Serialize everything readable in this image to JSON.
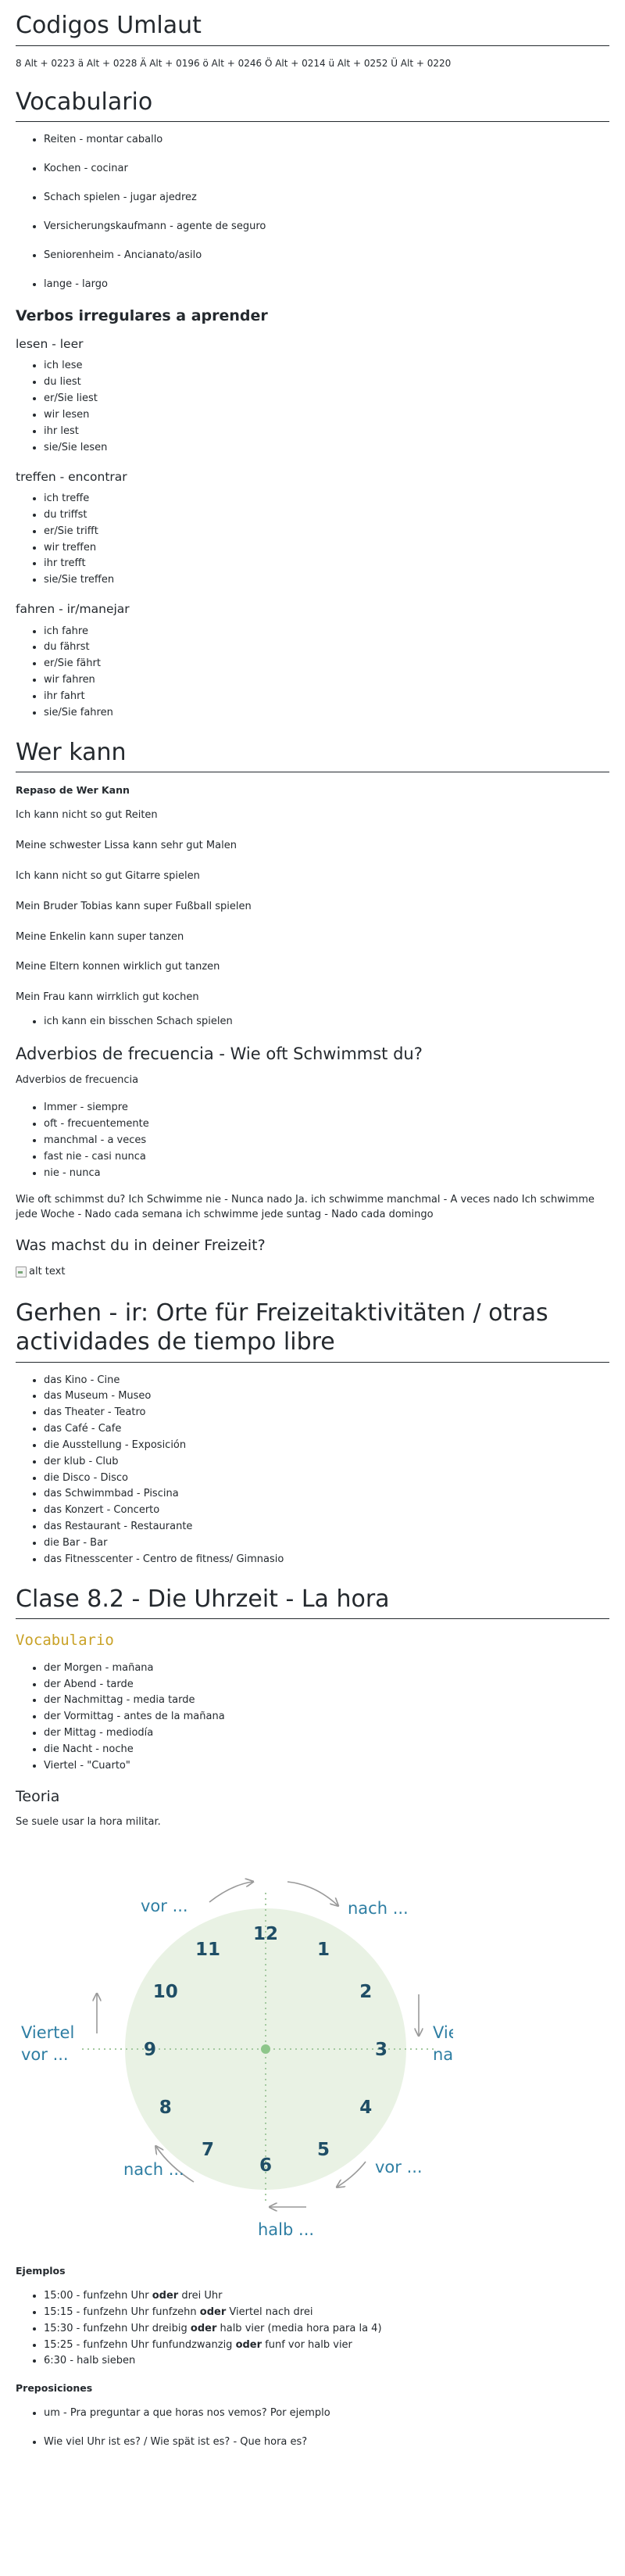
{
  "umlaut": {
    "title": "Codigos Umlaut",
    "codes": "8 Alt + 0223 ä Alt + 0228 Ä Alt + 0196 ö Alt + 0246 Ö Alt + 0214 ü Alt + 0252 Ü Alt + 0220"
  },
  "vocabulario": {
    "title": "Vocabulario",
    "items": [
      "Reiten - montar caballo",
      "Kochen - cocinar",
      "Schach spielen - jugar ajedrez",
      "Versicherungskaufmann - agente de seguro",
      "Seniorenheim - Ancianato/asilo",
      "lange - largo"
    ],
    "verbs_title": "Verbos irregulares a aprender",
    "verbs": [
      {
        "title": "lesen - leer",
        "forms": [
          "ich lese",
          "du liest",
          "er/Sie liest",
          "wir lesen",
          "ihr lest",
          "sie/Sie lesen"
        ]
      },
      {
        "title": "treffen - encontrar",
        "forms": [
          "ich treffe",
          "du triffst",
          "er/Sie trifft",
          "wir treffen",
          "ihr trefft",
          "sie/Sie treffen"
        ]
      },
      {
        "title": "fahren - ir/manejar",
        "forms": [
          "ich fahre",
          "du fährst",
          "er/Sie fährt",
          "wir fahren",
          "ihr fahrt",
          "sie/Sie fahren"
        ]
      }
    ]
  },
  "werkann": {
    "title": "Wer kann",
    "repaso": "Repaso de Wer Kann",
    "sentences": [
      "Ich kann nicht so gut Reiten",
      "Meine schwester Lissa kann sehr gut Malen",
      "Ich kann nicht so gut Gitarre spielen",
      "Mein Bruder Tobias kann super Fußball spielen",
      "Meine Enkelin kann super tanzen",
      "Meine Eltern konnen wirklich gut tanzen",
      "Mein Frau kann wirrklich gut kochen"
    ],
    "bullet": "ich kann ein bisschen Schach spielen",
    "adverbios_title": "Adverbios de frecuencia - Wie oft Schwimmst du?",
    "adverbios_intro": "Adverbios de frecuencia",
    "adverbios": [
      "Immer - siempre",
      "oft - frecuentemente",
      "manchmal - a veces",
      "fast nie - casi nunca",
      "nie - nunca"
    ],
    "paragraph": "Wie oft schimmst du? Ich Schwimme nie - Nunca nado Ja. ich schwimme manchmal - A veces nado Ich schwimme jede Woche - Nado cada semana ich schwimme jede suntag - Nado cada domingo",
    "freizeit_title": "Was machst du in deiner Freizeit?",
    "img_alt": "alt text"
  },
  "gehen": {
    "title": "Gerhen - ir: Orte für Freizeitaktivitäten / otras actividades de tiempo libre",
    "items": [
      "das Kino - Cine",
      "das Museum - Museo",
      "das Theater - Teatro",
      "das Café - Cafe",
      "die Ausstellung - Exposición",
      "der klub - Club",
      "die Disco - Disco",
      "das Schwimmbad - Piscina",
      "das Konzert - Concerto",
      "das Restaurant - Restaurante",
      "die Bar - Bar",
      "das Fitnesscenter - Centro de fitness/ Gimnasio"
    ]
  },
  "clase": {
    "title": "Clase 8.2 - Die Uhrzeit - La hora",
    "vocab_title": "Vocabulario",
    "vocab": [
      "der Morgen - mañana",
      "der Abend - tarde",
      "der Nachmittag - media tarde",
      "der Vormittag - antes de la mañana",
      "der Mittag - mediodía",
      "die Nacht - noche",
      "Viertel - \"Cuarto\""
    ],
    "teoria_title": "Teoria",
    "teoria_text": "Se suele usar la hora militar.",
    "clock": {
      "numbers": [
        "12",
        "1",
        "2",
        "3",
        "4",
        "5",
        "6",
        "7",
        "8",
        "9",
        "10",
        "11"
      ],
      "vor_top": "vor ...",
      "nach_top": "nach ...",
      "viertel": "Viertel",
      "vor_left": "vor ...",
      "nach_right": "nach ...",
      "nach_bottom": "nach ...",
      "vor_bottom": "vor ...",
      "halb": "halb ...",
      "face_color": "#e9f2e4",
      "number_color": "#1f4e66",
      "label_color": "#2e7ea3",
      "arrow_color": "#999999",
      "center_color": "#8dc68a"
    },
    "ejemplos_title": "Ejemplos",
    "ejemplos": [
      {
        "pre": "15:00 - funfzehn Uhr ",
        "bold": "oder",
        "post": " drei Uhr"
      },
      {
        "pre": "15:15 - funfzehn Uhr funfzehn ",
        "bold": "oder",
        "post": " Viertel nach drei"
      },
      {
        "pre": "15:30 - funfzehn Uhr dreibig ",
        "bold": "oder",
        "post": " halb vier (media hora para la 4)"
      },
      {
        "pre": "15:25 - funfzehn Uhr funfundzwanzig ",
        "bold": "oder",
        "post": " funf vor halb vier"
      },
      {
        "pre": "6:30 - halb sieben",
        "bold": "",
        "post": ""
      }
    ],
    "preposiciones_title": "Preposiciones",
    "preposiciones": [
      "um - Pra preguntar a que horas nos vemos? Por ejemplo",
      "Wie viel Uhr ist es? / Wie spät ist es? - Que hora es?"
    ]
  }
}
